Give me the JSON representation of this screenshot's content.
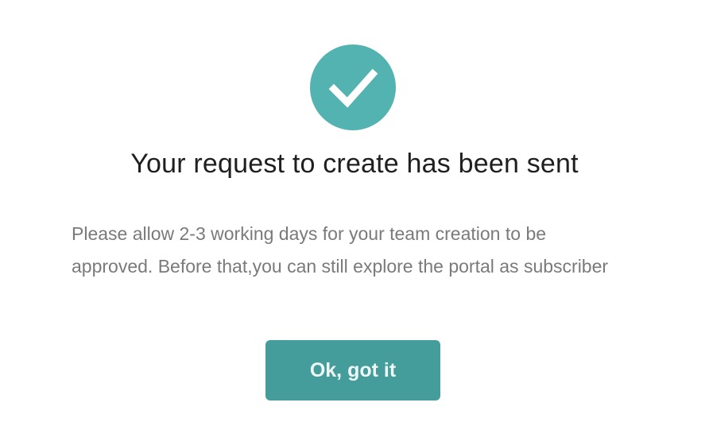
{
  "dialog": {
    "icon": "checkmark-circle-icon",
    "title": "Your request to create has been sent",
    "message": "Please allow 2-3 working days for your team creation to be approved. Before that,you can still explore the portal as subscriber",
    "ok_button_label": "Ok, got it"
  },
  "colors": {
    "accent": "#52b3b1",
    "button": "#449d9b",
    "title_text": "#1f1f1f",
    "body_text": "#7a7a7a"
  }
}
